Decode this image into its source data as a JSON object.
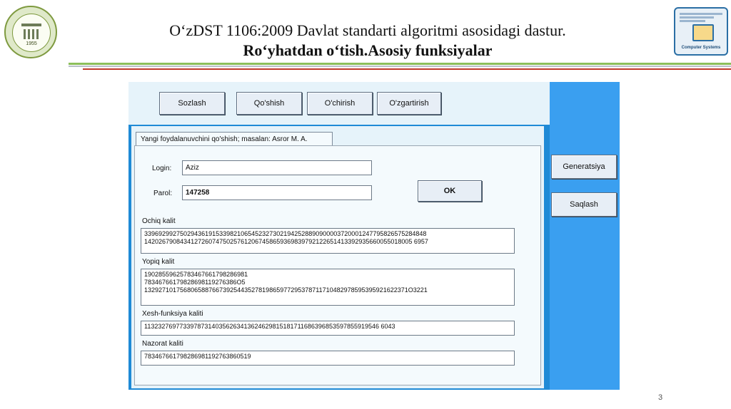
{
  "slide": {
    "title_line1": "O‘zDST 1106:2009 Davlat standarti algoritmi asosidagi dastur.",
    "title_line2": "Ro‘yhatdan o‘tish.Asosiy funksiyalar",
    "left_logo_year": "1955",
    "right_logo_label": "Computer Systems",
    "page_number": "3"
  },
  "colors": {
    "window_blue": "#1f8ad6",
    "panel_light": "#e6f3fa",
    "right_panel_blue": "#3a9ff0",
    "rule_green": "#8cbf5a",
    "rule_grey": "#b8c0c8",
    "rule_red": "#c0392b"
  },
  "toolbar": {
    "buttons": [
      "Sozlash",
      "Qo'shish",
      "O'chirish",
      "O'zgartirish"
    ]
  },
  "side": {
    "generate_label": "Generatsiya",
    "save_label": "Saqlash"
  },
  "tab": {
    "label": "Yangi foydalanuvchini qo'shish; masalan: Asror M. A."
  },
  "form": {
    "login_label": "Login:",
    "login_value": "Aziz",
    "password_label": "Parol:",
    "password_value": "147258",
    "ok_label": "OK",
    "open_key_label": "Ochiq kalit",
    "open_key_lines": [
      "3396929927502943619153398210654523273021942528890900003720001247795826575284848",
      "142026790843412726074750257612067458659369839792122651413392935660055018005 6957"
    ],
    "secret_key_label": "Yopiq kalit",
    "secret_key_lines": [
      "19028559625783467661798286981",
      "78346766179828698119276386O5",
      "13292710175680658876673925443527819865977295378711710482978595395921622371O3221"
    ],
    "hash_label": "Xesh-funksiya kaliti",
    "hash_value": "113232769773397873140356263413624629815181711686396853597855919546 6043",
    "control_label": "Nazorat kaliti",
    "control_value": "783467661798286981192763860519"
  }
}
